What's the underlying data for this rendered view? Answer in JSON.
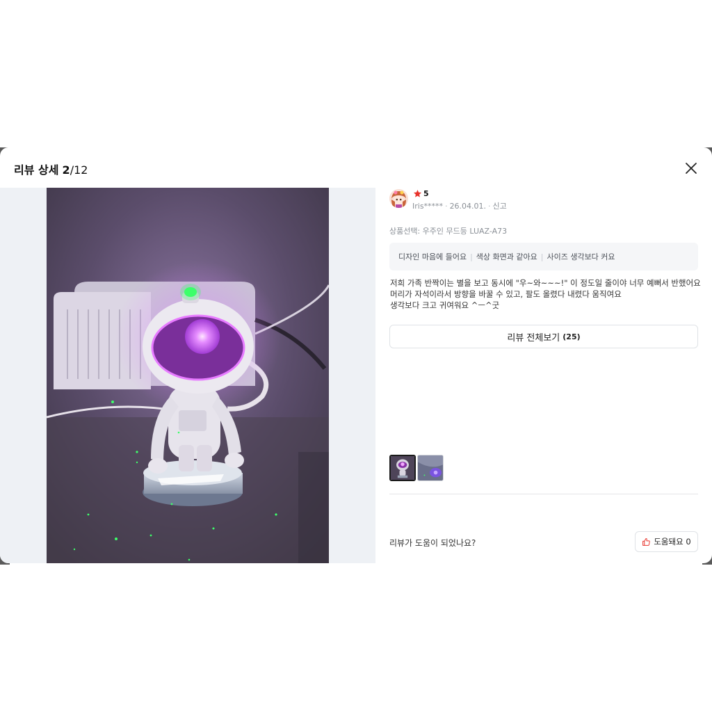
{
  "modal": {
    "title": "리뷰 상세",
    "page_current": "2",
    "page_total": "/12",
    "close_icon": "close-icon"
  },
  "review": {
    "rating_icon": "star-icon",
    "rating": "5",
    "author": "Iris*****",
    "date": "26.04.01.",
    "report_label": "신고",
    "option": "상품선택: 우주인 무드등 LUAZ-A73",
    "tags": [
      "디자인 마음에 들어요",
      "색상 화면과 같아요",
      "사이즈 생각보다 커요"
    ],
    "body_lines": [
      "저희 가족 반짝이는 별을 보고 동시에 \"우~와~~~!\" 이 정도일 줄이야 너무 예뻐서 반했어요",
      "머리가 자석이라서 방향을 바꿀 수 있고, 팔도 올렸다 내렸다 움직여요",
      "생각보다 크고 귀여워요 ^ㅡ^굿"
    ]
  },
  "all_reviews": {
    "label": "리뷰 전체보기",
    "count": "(25)"
  },
  "helpful": {
    "question": "리뷰가 도움이 되었나요?",
    "button_label": "도움돼요 0",
    "icon": "thumbs-up-icon"
  },
  "colors": {
    "accent_red": "#e8332b",
    "purple_glow": "#d65cff",
    "green_led": "#3dff6a"
  }
}
